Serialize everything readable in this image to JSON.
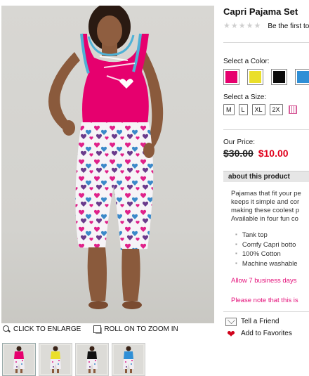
{
  "product": {
    "title": "Capri Pajama Set",
    "review_link": "Be the first to review",
    "stars": [
      "★",
      "★",
      "★",
      "★",
      "★"
    ]
  },
  "colors": {
    "label": "Select a Color:",
    "options": [
      {
        "name": "Pink",
        "hex": "#e6006e"
      },
      {
        "name": "Yellow",
        "hex": "#eadf2a"
      },
      {
        "name": "Black",
        "hex": "#0b0b0b"
      },
      {
        "name": "Blue",
        "hex": "#2f8fd6"
      }
    ]
  },
  "sizes": {
    "label": "Select a Size:",
    "options": [
      "M",
      "L",
      "XL",
      "2X"
    ]
  },
  "price": {
    "label": "Our Price:",
    "old": "$30.00",
    "new": "$10.00"
  },
  "about": {
    "heading": "about this product",
    "description_lines": [
      "Pajamas that fit your pe",
      "keeps it simple and cor",
      "making these coolest p",
      "Available in four fun co"
    ],
    "features": [
      "Tank top",
      "Comfy Capri botto",
      "100% Cotton",
      "Machine washable"
    ],
    "notice_1": "Allow 7 business days",
    "notice_2": "Please note that this is"
  },
  "actions": {
    "tell_friend": "Tell a Friend",
    "add_favorites": "Add to Favorites"
  },
  "image_tools": {
    "enlarge": "CLICK TO ENLARGE",
    "zoom": "ROLL ON TO ZOOM IN"
  },
  "thumbnails": [
    {
      "color": "Pink",
      "top_hex": "#e6006e"
    },
    {
      "color": "Yellow",
      "top_hex": "#eadf2a"
    },
    {
      "color": "Black",
      "top_hex": "#111111"
    },
    {
      "color": "Blue",
      "top_hex": "#2f8fd6"
    }
  ],
  "theme": {
    "sale_red": "#e0001b",
    "notice_pink": "#e4117a"
  }
}
